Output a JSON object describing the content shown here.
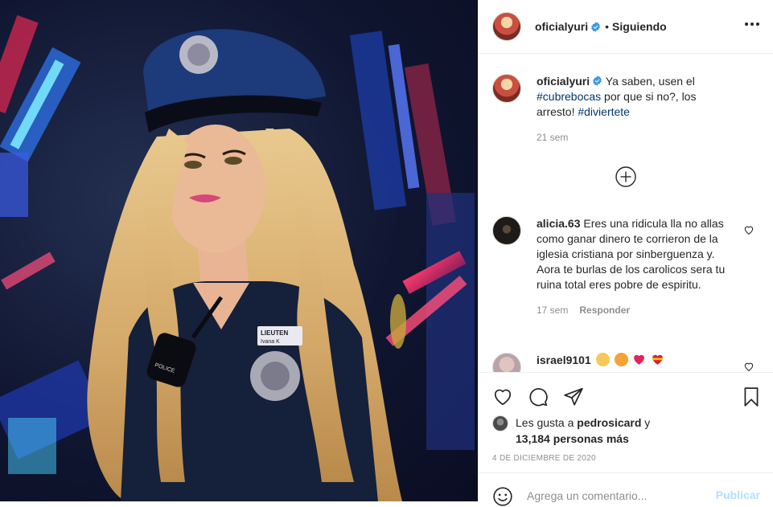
{
  "post": {
    "author": "oficialyuri",
    "follow_status": "Siguiendo",
    "caption": {
      "before": "Ya saben, usen el ",
      "hashtag1": "#cubrebocas",
      "middle": " por que si no?, los arresto! ",
      "hashtag2": "#diviertete"
    },
    "caption_time": "21 sem",
    "image_labels": {
      "badge_name": "LIEUTEN",
      "badge_sub": "Ivana K",
      "radio": "POLICE"
    }
  },
  "comments": [
    {
      "username": "alicia.63",
      "text": "Eres una ridicula lla no allas como ganar dinero te corrieron de la iglesia cristiana por sinberguenza y. Aora te burlas de los carolicos sera tu ruina total eres pobre de espiritu.",
      "time": "17 sem",
      "reply_label": "Responder"
    },
    {
      "username": "israel9101"
    }
  ],
  "likes": {
    "prefix": "Les gusta a ",
    "user": "pedrosicard",
    "joiner": " y",
    "count_text": "13,184 personas más"
  },
  "date": "4 de diciembre de 2020",
  "add_comment": {
    "placeholder": "Agrega un comentario...",
    "publish_label": "Publicar"
  },
  "colors": {
    "verified": "#3897f0",
    "hashtag": "#00376b",
    "muted": "#8e8e8e",
    "publish_disabled": "#b2dffc",
    "heart_red": "#ed4956"
  },
  "icons": [
    "more-options-icon",
    "verified-icon",
    "plus-circle-icon",
    "heart-icon",
    "comment-icon",
    "share-icon",
    "bookmark-icon",
    "smile-icon"
  ]
}
